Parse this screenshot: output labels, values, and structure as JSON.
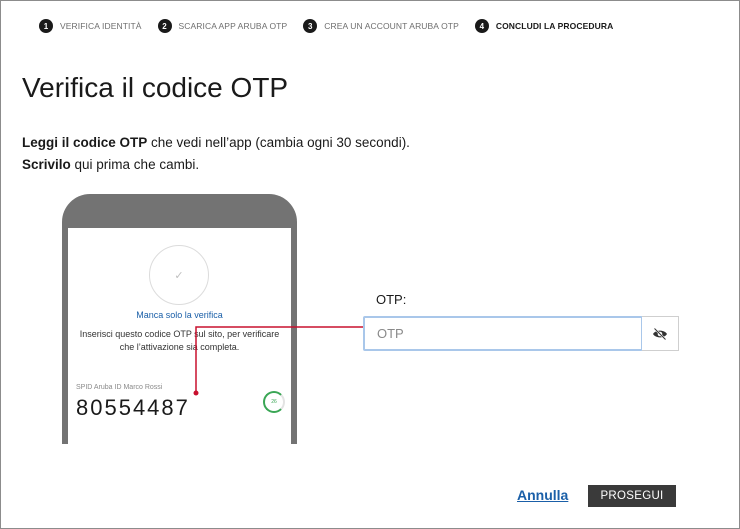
{
  "stepper": {
    "steps": [
      {
        "number": "1",
        "label": "VERIFICA IDENTITÀ"
      },
      {
        "number": "2",
        "label": "SCARICA APP ARUBA OTP"
      },
      {
        "number": "3",
        "label": "CREA UN ACCOUNT ARUBA OTP"
      },
      {
        "number": "4",
        "label": "CONCLUDI LA PROCEDURA"
      }
    ],
    "active_step": 4
  },
  "page": {
    "title": "Verifica il codice OTP"
  },
  "instructions": {
    "line1_bold": "Leggi il codice OTP",
    "line1_rest": " che vedi nell’app (cambia ogni 30 secondi).",
    "line2_bold": "Scrivilo",
    "line2_rest": " qui prima che cambi."
  },
  "phone": {
    "check_icon": "check-icon",
    "status": "Manca solo la verifica",
    "message": "Inserisci questo codice OTP sul sito, per verificare che l’attivazione sia completa.",
    "account": "SPID Aruba ID Marco Rossi",
    "code": "80554487",
    "timer_seconds": "26"
  },
  "form": {
    "otp_label": "OTP:",
    "otp_value": "",
    "otp_placeholder": "OTP",
    "toggle_icon": "eye-slash-icon"
  },
  "actions": {
    "cancel_label": "Annulla",
    "proceed_label": "PROSEGUI"
  },
  "colors": {
    "accent_link": "#1a5fa8",
    "connector": "#c8102e",
    "timer": "#3aa655",
    "button_bg": "#3a3a3a"
  }
}
